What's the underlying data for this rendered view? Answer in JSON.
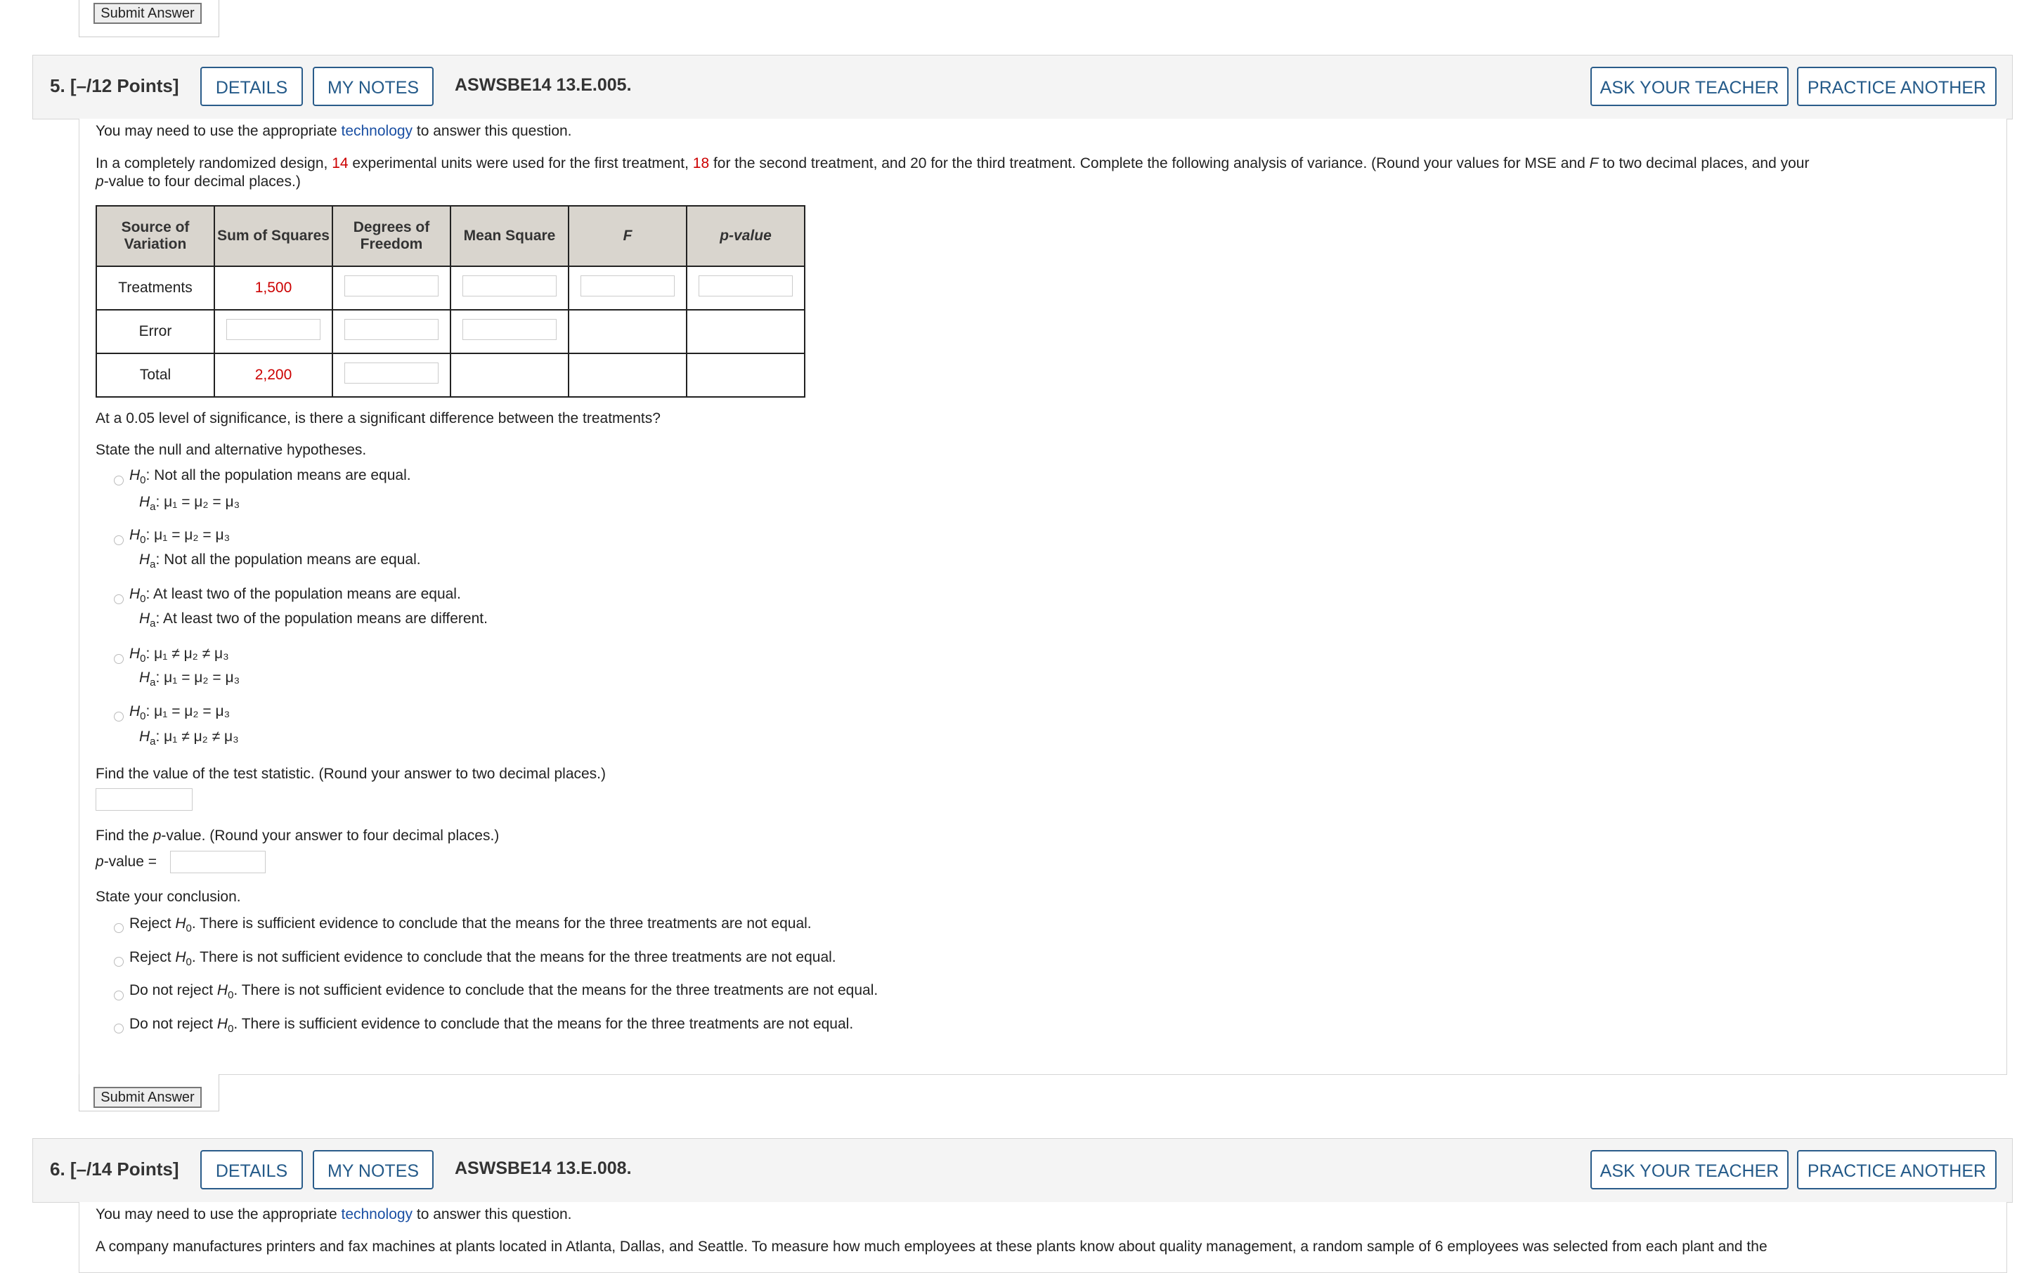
{
  "top_submit": {
    "label": "Submit Answer"
  },
  "q5": {
    "number": "5. [–/12 Points]",
    "details": "DETAILS",
    "my_notes": "MY NOTES",
    "code": "ASWSBE14 13.E.005.",
    "ask_teacher": "ASK YOUR TEACHER",
    "practice_another": "PRACTICE ANOTHER",
    "tech_pre": "You may need to use the appropriate ",
    "tech_link": "technology",
    "tech_post": " to answer this question.",
    "prompt_1a": "In a completely randomized design, ",
    "prompt_1b": "14",
    "prompt_1c": " experimental units were used for the first treatment, ",
    "prompt_1d": "18",
    "prompt_1e": " for the second treatment, and 20 for the third treatment. Complete the following analysis of variance. (Round your values for MSE and ",
    "prompt_1f": "F",
    "prompt_1g": " to two decimal places, and your",
    "prompt_2a": "p",
    "prompt_2b": "-value to four decimal places.)",
    "table": {
      "h_source": "Source of Variation",
      "h_ss": "Sum of Squares",
      "h_df": "Degrees of Freedom",
      "h_ms": "Mean Square",
      "h_f": "F",
      "h_p": "p-value",
      "r_treat": "Treatments",
      "r_treat_ss": "1,500",
      "r_error": "Error",
      "r_total": "Total",
      "r_total_ss": "2,200"
    },
    "sig_question": "At a 0.05 level of significance, is there a significant difference between the treatments?",
    "state_hyp": "State the null and alternative hypotheses.",
    "opt1_h0": ": Not all the population means are equal.",
    "opt1_ha": ": μ₁ = μ₂ = μ₃",
    "opt2_h0": ": μ₁ = μ₂ = μ₃",
    "opt2_ha": ": Not all the population means are equal.",
    "opt3_h0": ": At least two of the population means are equal.",
    "opt3_ha": ": At least two of the population means are different.",
    "opt4_h0": ": μ₁ ≠ μ₂ ≠ μ₃",
    "opt4_ha": ": μ₁ = μ₂ = μ₃",
    "opt5_h0": ": μ₁ = μ₂ = μ₃",
    "opt5_ha": ": μ₁ ≠ μ₂ ≠ μ₃",
    "find_stat": "Find the value of the test statistic. (Round your answer to two decimal places.)",
    "find_p_a": "Find the ",
    "find_p_b": "p",
    "find_p_c": "-value. (Round your answer to four decimal places.)",
    "pvalue_label_a": "p",
    "pvalue_label_b": "-value =",
    "state_conc": "State your conclusion.",
    "conc1_a": "Reject ",
    "conc1_b": ". There is sufficient evidence to conclude that the means for the three treatments are not equal.",
    "conc2_a": "Reject ",
    "conc2_b": ". There is not sufficient evidence to conclude that the means for the three treatments are not equal.",
    "conc3_a": "Do not reject ",
    "conc3_b": ". There is not sufficient evidence to conclude that the means for the three treatments are not equal.",
    "conc4_a": "Do not reject ",
    "conc4_b": ". There is sufficient evidence to conclude that the means for the three treatments are not equal.",
    "submit": "Submit Answer"
  },
  "q6": {
    "number": "6. [–/14 Points]",
    "details": "DETAILS",
    "my_notes": "MY NOTES",
    "code": "ASWSBE14 13.E.008.",
    "ask_teacher": "ASK YOUR TEACHER",
    "practice_another": "PRACTICE ANOTHER",
    "tech_pre": "You may need to use the appropriate ",
    "tech_link": "technology",
    "tech_post": " to answer this question.",
    "prompt": "A company manufactures printers and fax machines at plants located in Atlanta, Dallas, and Seattle. To measure how much employees at these plants know about quality management, a random sample of 6 employees was selected from each plant and the"
  },
  "symbols": {
    "H": "H",
    "sub0": "0",
    "suba": "a"
  }
}
